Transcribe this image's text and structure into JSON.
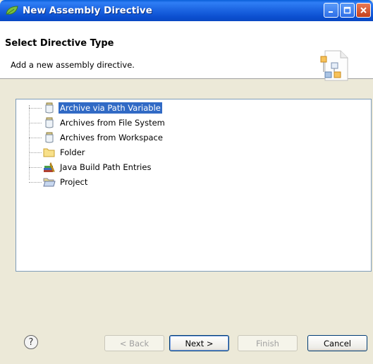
{
  "window": {
    "title": "New Assembly Directive"
  },
  "banner": {
    "title": "Select Directive Type",
    "subtitle": "Add a new assembly directive."
  },
  "tree": {
    "items": [
      {
        "label": "Archive via Path Variable",
        "icon": "jar-icon",
        "selected": true
      },
      {
        "label": "Archives from File System",
        "icon": "jar-icon",
        "selected": false
      },
      {
        "label": "Archives from Workspace",
        "icon": "jar-icon",
        "selected": false
      },
      {
        "label": "Folder",
        "icon": "folder-icon",
        "selected": false
      },
      {
        "label": "Java Build Path Entries",
        "icon": "library-icon",
        "selected": false
      },
      {
        "label": "Project",
        "icon": "open-folder-icon",
        "selected": false
      }
    ]
  },
  "buttons": {
    "help": "?",
    "back": "< Back",
    "next": "Next >",
    "finish": "Finish",
    "cancel": "Cancel"
  }
}
